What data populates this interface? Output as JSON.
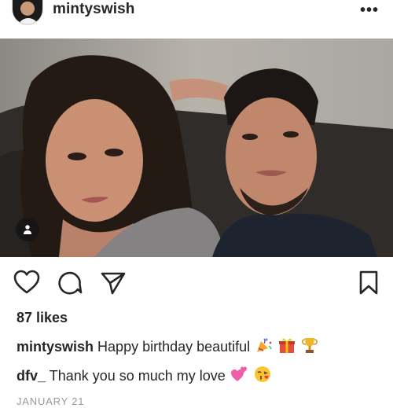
{
  "header": {
    "avatar": "profile-avatar",
    "username": "mintyswish",
    "more_label": "•••"
  },
  "photo": {
    "tag_icon": "person-icon"
  },
  "actions": {
    "icons": [
      "heart-icon",
      "comment-icon",
      "paper-plane-icon",
      "bookmark-icon"
    ]
  },
  "likes_text": "87 likes",
  "caption": {
    "user": "mintyswish",
    "text": "Happy birthday beautiful",
    "emojis": [
      "party-popper",
      "wrapped-gift",
      "trophy"
    ]
  },
  "comment": {
    "user": "dfv_",
    "text": "Thank you so much my love",
    "emojis": [
      "two-hearts",
      "face-blowing-kiss"
    ]
  },
  "date": "JANUARY 21",
  "colors": {
    "text": "#262626",
    "muted": "#999999",
    "background": "#ffffff"
  }
}
